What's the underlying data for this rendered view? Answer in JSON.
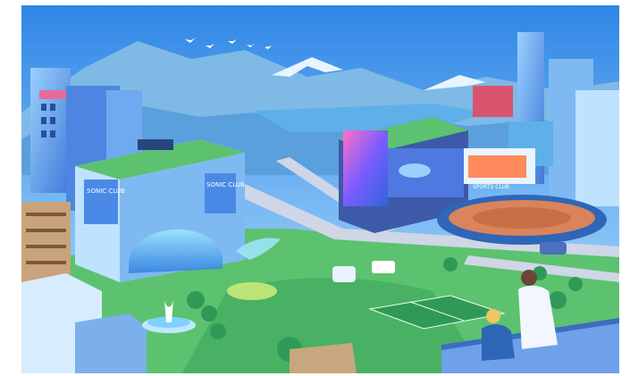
{
  "illustration": {
    "subject": "isometric-smart-city",
    "colors": {
      "sky_top": "#2f86e6",
      "sky_bottom": "#b7e3ff",
      "mountain": "#7fb9e6",
      "snow": "#e8f4ff",
      "lake": "#5fb0e8",
      "grass": "#5cc26f",
      "grass_dark": "#2f9a58",
      "road": "#cfd6e6",
      "stadium_track": "#d9845a",
      "building_blue": "#3f79d6",
      "building_light": "#9ad0ff",
      "screen_pink": "#d84ca5"
    }
  },
  "signs": {
    "left_building_1": "SONIC CLUB",
    "left_building_2": "SONIC CLUB",
    "stadium_sign": "SPORTS CLUB"
  }
}
